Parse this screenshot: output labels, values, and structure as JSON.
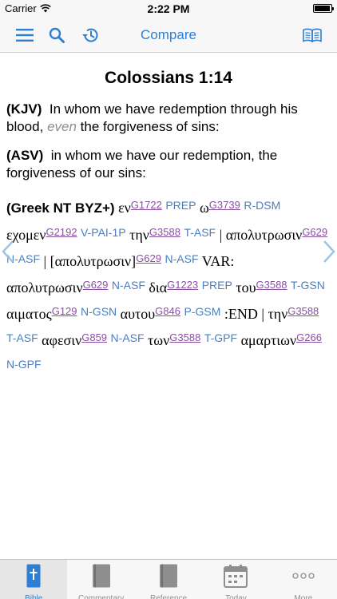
{
  "status_bar": {
    "carrier": "Carrier",
    "time": "2:22 PM"
  },
  "nav_bar": {
    "title": "Compare"
  },
  "verse": {
    "reference": "Colossians 1:14",
    "kjv": {
      "tag": "(KJV)",
      "text_before": "In whom we have redemption through his blood,",
      "italic": "even",
      "text_after": "the forgiveness of sins:"
    },
    "asv": {
      "tag": "(ASV)",
      "text": "in whom we have our redemption, the forgiveness of our sins:"
    },
    "greek": {
      "tag": "(Greek NT BYZ+)",
      "words": [
        {
          "w": "εν",
          "s": "G1722",
          "m": "PREP"
        },
        {
          "w": "ω",
          "s": "G3739",
          "m": "R-DSM"
        },
        {
          "w": "εχομεν",
          "s": "G2192",
          "m": "V-PAI-1P"
        },
        {
          "w": "την",
          "s": "G3588",
          "m": "T-ASF"
        },
        {
          "w": "|",
          "s": "",
          "m": ""
        },
        {
          "w": "απολυτρωσιν",
          "s": "G629",
          "m": "N-ASF"
        },
        {
          "w": "|",
          "s": "",
          "m": ""
        },
        {
          "w": "[απολυτρωσιν]",
          "s": "G629",
          "m": "N-ASF"
        },
        {
          "w": "VAR:",
          "s": "",
          "m": ""
        },
        {
          "w": "απολυτρωσιν",
          "s": "G629",
          "m": "N-ASF"
        },
        {
          "w": "δια",
          "s": "G1223",
          "m": "PREP"
        },
        {
          "w": "του",
          "s": "G3588",
          "m": "T-GSN"
        },
        {
          "w": "αιματος",
          "s": "G129",
          "m": "N-GSN"
        },
        {
          "w": "αυτου",
          "s": "G846",
          "m": "P-GSM"
        },
        {
          "w": ":END | την",
          "s": "G3588",
          "m": "T-ASF"
        },
        {
          "w": "αφεσιν",
          "s": "G859",
          "m": "N-ASF"
        },
        {
          "w": "των",
          "s": "G3588",
          "m": "T-GPF"
        },
        {
          "w": "αμαρτιων",
          "s": "G266",
          "m": "N-GPF"
        }
      ]
    }
  },
  "tabs": [
    {
      "label": "Bible",
      "icon": "bible-icon",
      "active": true
    },
    {
      "label": "Commentary",
      "icon": "book-icon",
      "active": false
    },
    {
      "label": "Reference",
      "icon": "book-icon",
      "active": false
    },
    {
      "label": "Today",
      "icon": "calendar-icon",
      "active": false
    },
    {
      "label": "More",
      "icon": "more-icon",
      "active": false
    }
  ],
  "colors": {
    "accent": "#2d7fd3",
    "strong_link": "#8a4fa3",
    "morph": "#4a7ec0"
  }
}
